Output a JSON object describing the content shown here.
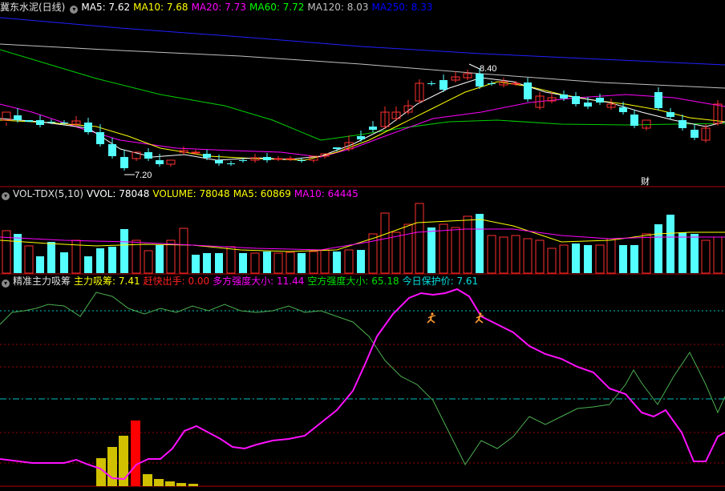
{
  "main_panel": {
    "title": "冀东水泥(日线)",
    "ma_labels": [
      {
        "text": "MA5: 7.62",
        "color": "#ffffff"
      },
      {
        "text": "MA10: 7.68",
        "color": "#ffff00"
      },
      {
        "text": "MA20: 7.73",
        "color": "#ff00ff"
      },
      {
        "text": "MA60: 7.72",
        "color": "#00ff00"
      },
      {
        "text": "MA120: 8.03",
        "color": "#c0c0c0"
      },
      {
        "text": "MA250: 8.33",
        "color": "#0000ff"
      }
    ],
    "high_label": "8.40",
    "low_label": "7.20",
    "finance_marker": "财"
  },
  "volume_panel": {
    "title": "VOL-TDX(5,10)",
    "labels": [
      {
        "text": "VVOL: 78048",
        "color": "#ffffff"
      },
      {
        "text": "VOLUME: 78048",
        "color": "#ffff00"
      },
      {
        "text": "MA5: 60869",
        "color": "#ffff00"
      },
      {
        "text": "MA10: 64445",
        "color": "#ff00ff"
      }
    ]
  },
  "indicator_panel": {
    "title": "精准主力吸筹",
    "labels": [
      {
        "text": "主力吸筹: 7.41",
        "color": "#ffff00"
      },
      {
        "text": "赶快出手: 0.00",
        "color": "#ff2020"
      },
      {
        "text": "多方强度大小: 11.44",
        "color": "#ff00ff"
      },
      {
        "text": "空方强度大小: 65.18",
        "color": "#00e000"
      },
      {
        "text": "今日保护价: 7.61",
        "color": "#00e0e0"
      }
    ]
  },
  "colors": {
    "up": "#ff3030",
    "down": "#54ffff",
    "border": "#b00000",
    "background": "#000000"
  },
  "icons": {
    "collapse_toggle": "circle-toggle-icon",
    "signal": "running-person-icon"
  }
}
